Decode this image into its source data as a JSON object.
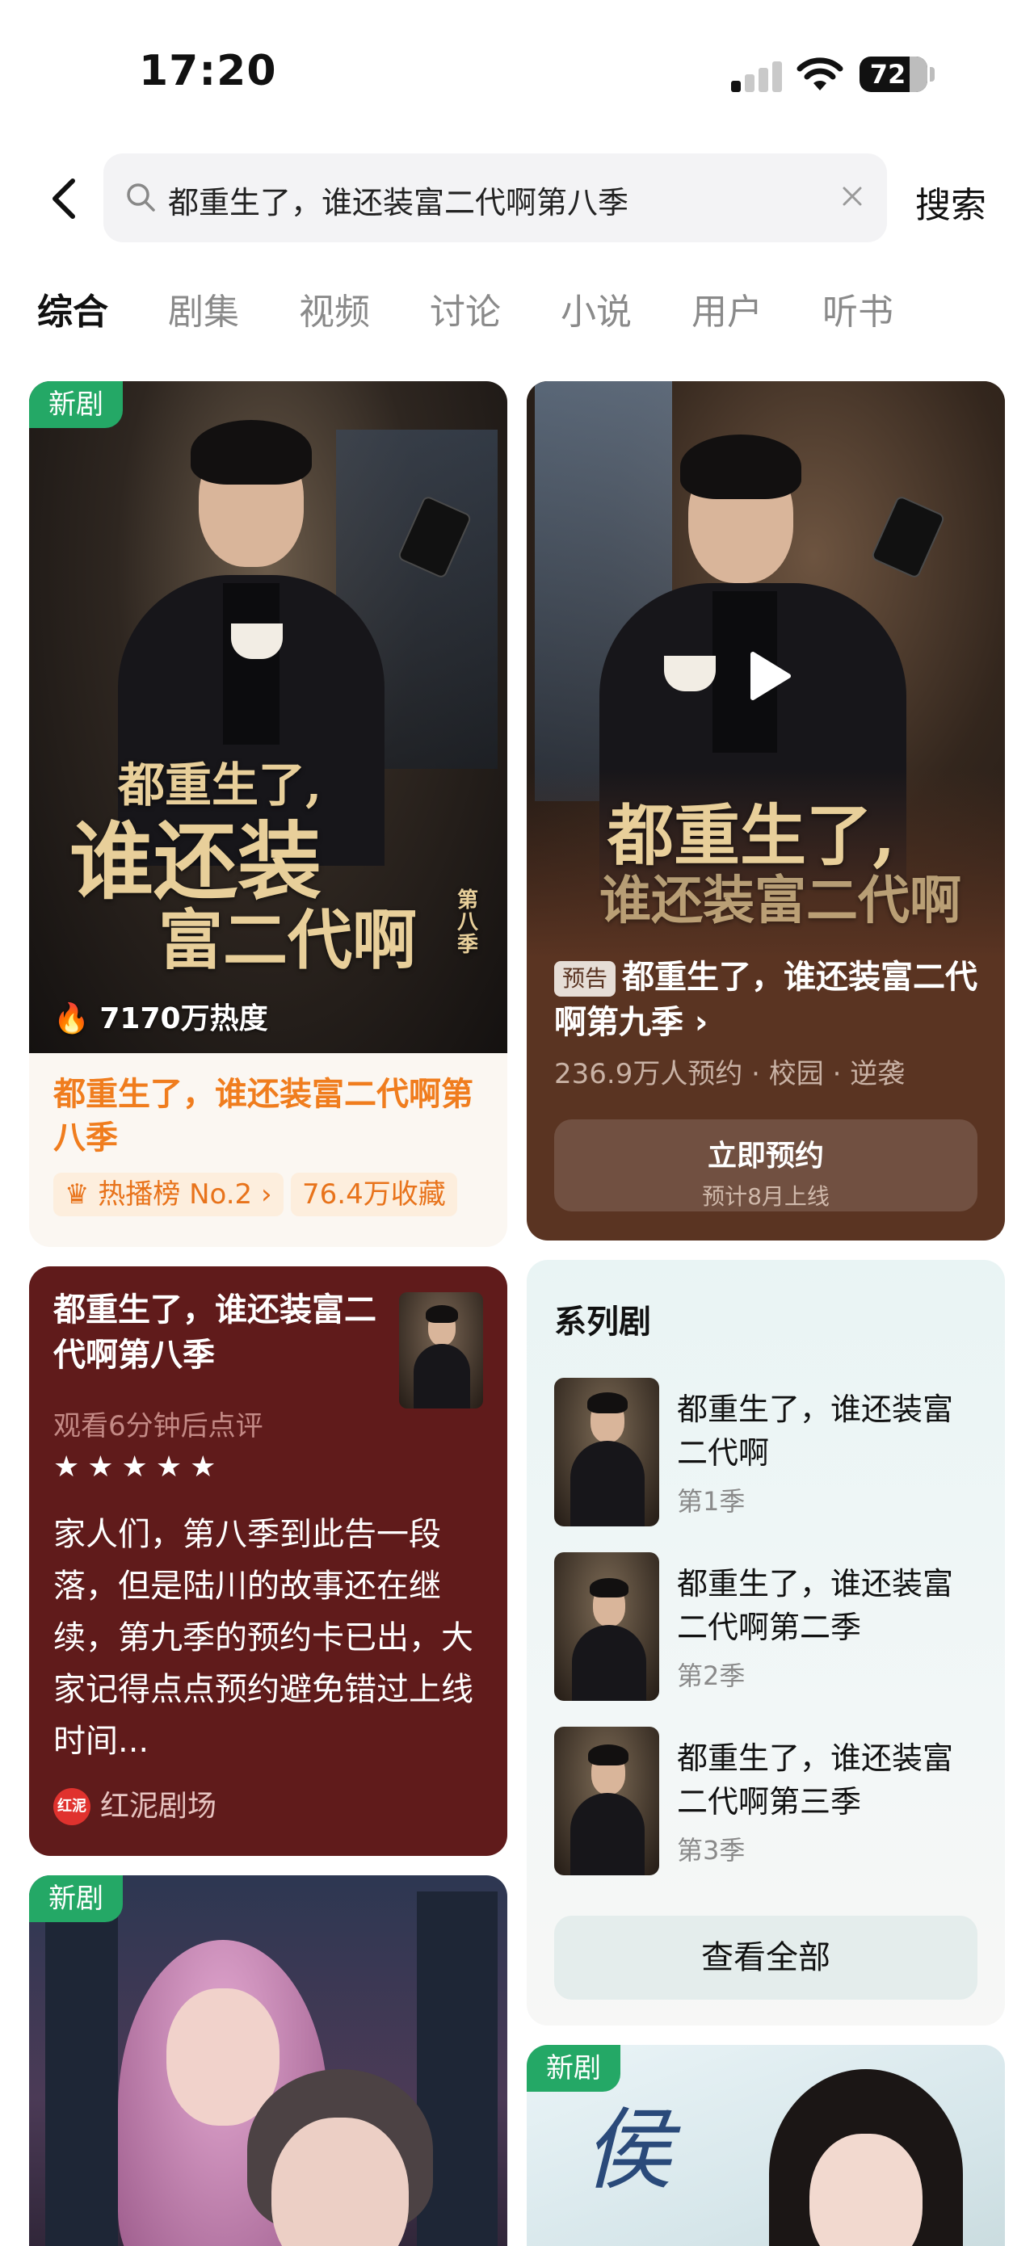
{
  "status_bar": {
    "time": "17:20",
    "battery": "72"
  },
  "search": {
    "query": "都重生了，谁还装富二代啊第八季",
    "button": "搜索"
  },
  "tabs": [
    "综合",
    "剧集",
    "视频",
    "讨论",
    "小说",
    "用户",
    "听书"
  ],
  "active_tab": 0,
  "cards": {
    "drama_main": {
      "badge": "新剧",
      "poster_line1": "都重生了,",
      "poster_line2": "谁还装",
      "poster_line3": "富二代啊",
      "poster_season": "第八季",
      "heat": "7170万热度",
      "title": "都重生了，谁还装富二代啊第八季",
      "rank": "热播榜 No.2",
      "collect": "76.4万收藏"
    },
    "preview": {
      "poster_line1": "都重生了,",
      "poster_line2": "谁还装富二代啊",
      "tag": "预告",
      "title": "都重生了，谁还装富二代啊第九季",
      "meta": "236.9万人预约 · 校园 · 逆袭",
      "button": "立即预约",
      "button_sub": "预计8月上线"
    },
    "review": {
      "title": "都重生了，谁还装富二代啊第八季",
      "sub": "观看6分钟后点评",
      "stars": "★★★★★",
      "body": "家人们，第八季到此告一段落，但是陆川的故事还在继续，第九季的预约卡已出，大家记得点点预约避免错过上线时间...",
      "source_logo": "红泥",
      "source": "红泥剧场"
    },
    "series": {
      "title": "系列剧",
      "items": [
        {
          "name": "都重生了，谁还装富二代啊",
          "season": "第1季"
        },
        {
          "name": "都重生了，谁还装富二代啊第二季",
          "season": "第2季"
        },
        {
          "name": "都重生了，谁还装富二代啊第三季",
          "season": "第3季"
        }
      ],
      "view_all": "查看全部"
    },
    "drama_next": {
      "badge": "新剧"
    },
    "drama_next2": {
      "badge": "新剧",
      "script": "侯"
    }
  },
  "colors": {
    "accent_orange": "#f07d1e",
    "badge_green": "#24a866",
    "preview_bg": "#5a3422",
    "review_bg": "#601b1b"
  }
}
